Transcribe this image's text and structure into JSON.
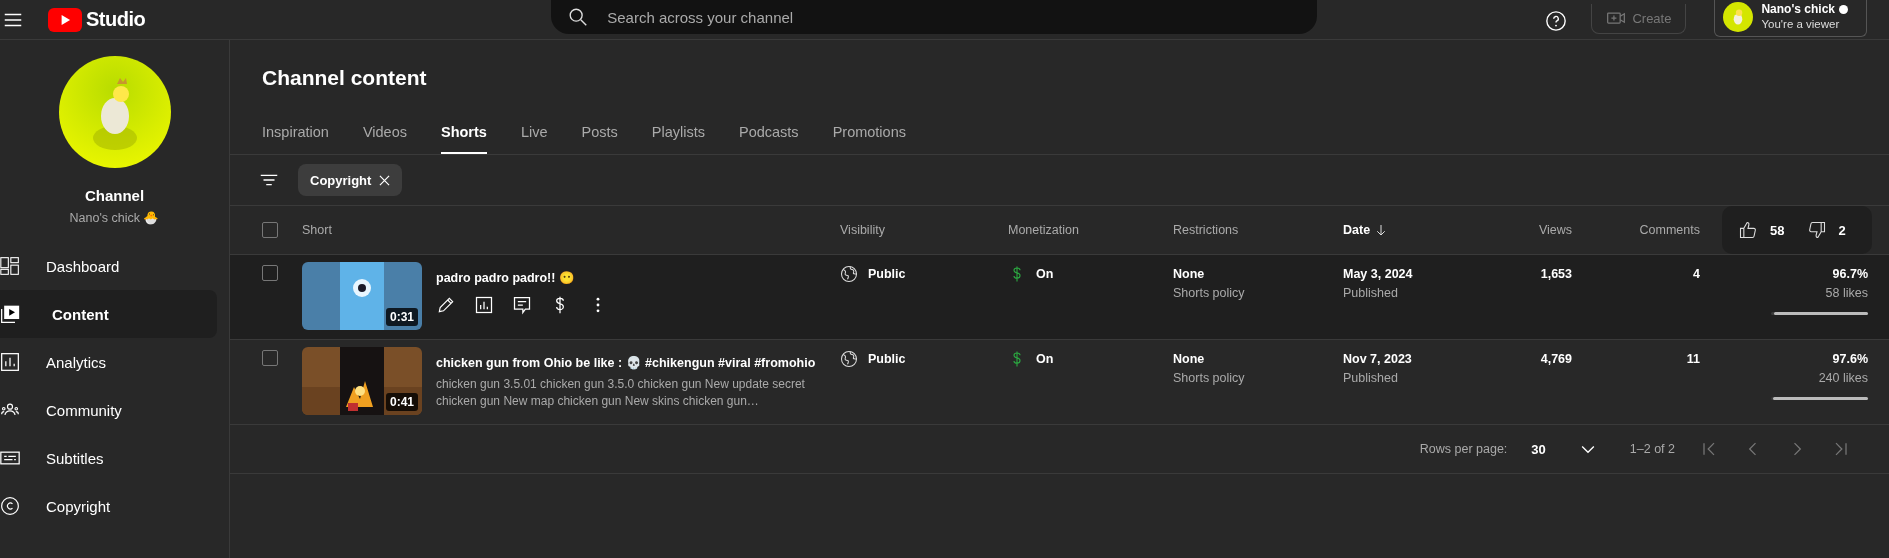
{
  "topbar": {
    "logo_text": "Studio",
    "search": {
      "placeholder": "Search across your channel"
    },
    "create_button": {
      "label": "Create",
      "disabled": true
    },
    "account": {
      "name": "Nano's chick",
      "role": "You're a viewer"
    }
  },
  "sidebar": {
    "channel_label": "Channel",
    "channel_name": "Nano's chick 🐣",
    "items": [
      {
        "label": "Dashboard",
        "kind": "dashboard",
        "selected": false
      },
      {
        "label": "Content",
        "kind": "content",
        "selected": true
      },
      {
        "label": "Analytics",
        "kind": "analytics",
        "selected": false
      },
      {
        "label": "Community",
        "kind": "community",
        "selected": false
      },
      {
        "label": "Subtitles",
        "kind": "subtitles",
        "selected": false
      },
      {
        "label": "Copyright",
        "kind": "copyright",
        "selected": false
      }
    ]
  },
  "page": {
    "title": "Channel content",
    "tabs": [
      {
        "label": "Inspiration",
        "selected": false
      },
      {
        "label": "Videos",
        "selected": false
      },
      {
        "label": "Shorts",
        "selected": true
      },
      {
        "label": "Live",
        "selected": false
      },
      {
        "label": "Posts",
        "selected": false
      },
      {
        "label": "Playlists",
        "selected": false
      },
      {
        "label": "Podcasts",
        "selected": false
      },
      {
        "label": "Promotions",
        "selected": false
      }
    ],
    "filter_chip": {
      "label": "Copyright"
    }
  },
  "table": {
    "columns": [
      {
        "label": "Short",
        "sorted": false
      },
      {
        "label": "Visibility",
        "sorted": false
      },
      {
        "label": "Monetization",
        "sorted": false
      },
      {
        "label": "Restrictions",
        "sorted": false
      },
      {
        "label": "Date",
        "sorted": true
      },
      {
        "label": "Views",
        "sorted": false
      },
      {
        "label": "Comments",
        "sorted": false
      }
    ],
    "all_checked": false,
    "likes_summary": {
      "likes": "58",
      "dislikes": "2"
    },
    "rows": [
      {
        "checked": false,
        "title": "padro padro padro!! 😶",
        "duration": "0:31",
        "hovered": true,
        "visibility": "Public",
        "monetization": "On",
        "restriction": "None",
        "restriction_reason": "Shorts policy",
        "date": "May 3, 2024",
        "date_status": "Published",
        "views": "1,653",
        "comments": "4",
        "like_ratio": "96.7%",
        "likes": "58 likes",
        "level": 0.967
      },
      {
        "checked": false,
        "title": "chicken gun from Ohio be like : 💀 #chikengun #viral #fromohio",
        "description": "chicken gun 3.5.01 chicken gun 3.5.0 chicken gun New update secret chicken gun New map chicken gun New skins chicken gun…",
        "duration": "0:41",
        "hovered": false,
        "visibility": "Public",
        "monetization": "On",
        "restriction": "None",
        "restriction_reason": "Shorts policy",
        "date": "Nov 7, 2023",
        "date_status": "Published",
        "views": "4,769",
        "comments": "11",
        "like_ratio": "97.6%",
        "likes": "240 likes",
        "level": 0.976
      }
    ]
  },
  "pagination": {
    "label": "Rows per page:",
    "rows_per_page": "30",
    "range": "1–2 of 2"
  }
}
